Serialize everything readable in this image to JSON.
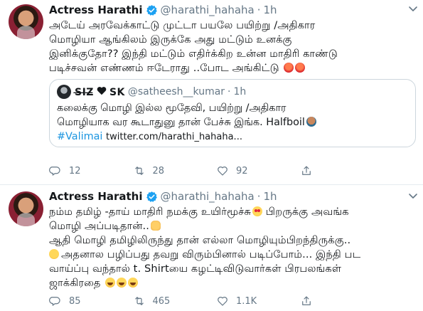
{
  "tweets": [
    {
      "name": "Actress Harathi",
      "handle": "@harathi_hahaha",
      "separator": "·",
      "time": "1h",
      "lines": [
        "அடேய் அரவேக்காட்டு முட்டா பயலே பயிற்று /அதிகார",
        "மொழியா ஆங்கிலம் இருக்கே அது மட்டும் உனக்கு",
        "இனிக்குதோ?? இந்தி மட்டும் எதிர்க்கிற உன்ன மாதிரி காண்டு",
        "படிச்சவன் எண்ணம் ஈடேராது ..போட அங்கிட்டு"
      ],
      "emoji_end": [
        "angry-face",
        "angry-face"
      ],
      "quote": {
        "name_left": "S̶I̶Z̶",
        "name_right": "SK",
        "handle": "@satheesh__kumar",
        "separator": "·",
        "time": "1h",
        "lines": [
          "கலைக்கு மொழி இல்ல மூதேவி, பயிற்று /அதிகார",
          "மொழியாக வர கூடாதுனு தான் பேச்சு இங்க. Halfboil"
        ],
        "hashtag": "#Valimai",
        "link": "twitter.com/harathi_hahaha..."
      },
      "stats": {
        "replies": "12",
        "retweets": "28",
        "likes": "92"
      }
    },
    {
      "name": "Actress Harathi",
      "handle": "@harathi_hahaha",
      "separator": "·",
      "time": "1h",
      "line1": "நம்ம தமிழ் -தாய் மாதிரி நமக்கு உயிர்மூச்சு",
      "line1b": "பிறருக்கு அவங்க",
      "line2": "மொழி அப்படிதான்..",
      "line3": "ஆதி மொழி தமிழிலிருந்து தான் எல்லா மொழியும்பிறந்திருக்கு..",
      "line4": "அதனால பழிப்பது தவறு விரும்பினால் படிப்போம்... இந்தி பட",
      "line5": "வாய்ப்பு வந்தால் t. Shirtயை கழட்டிவிடுவார்கள் பிரபலங்கள்",
      "line6": "ஜாக்கிரதை",
      "stats": {
        "replies": "85",
        "retweets": "465",
        "likes": "1.1K"
      }
    }
  ]
}
